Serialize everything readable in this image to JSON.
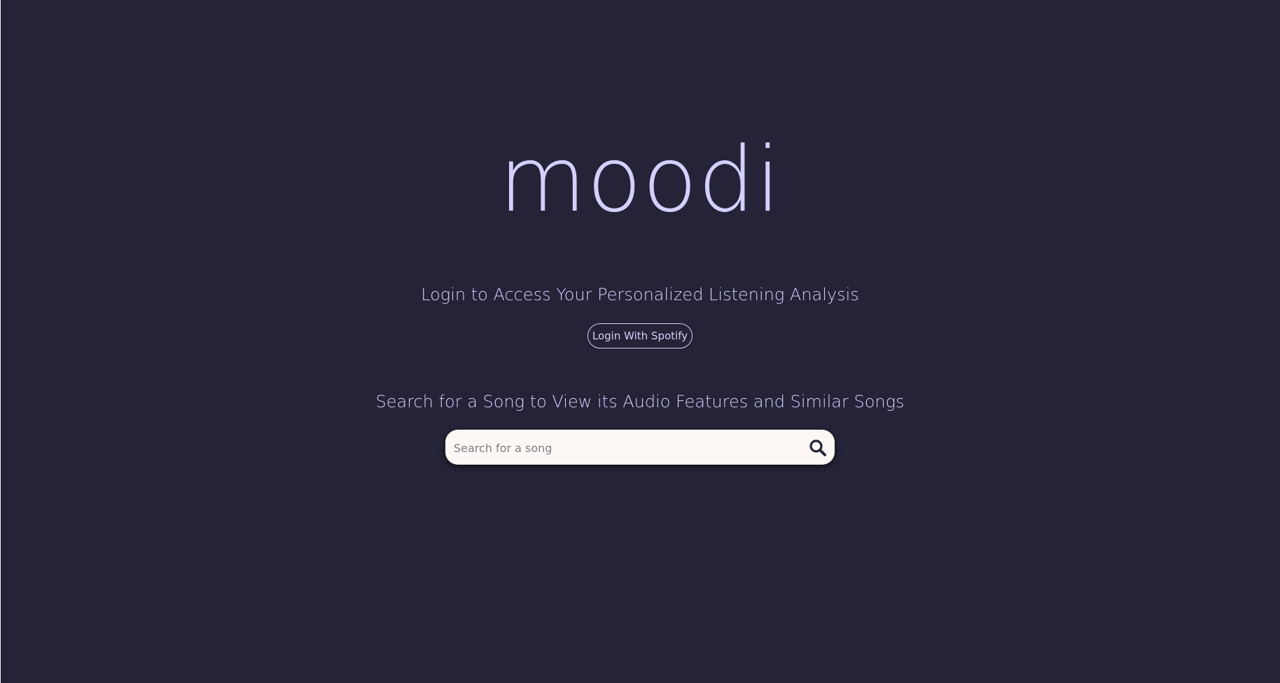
{
  "logo": {
    "text": "moodi"
  },
  "login": {
    "heading": "Login to Access Your Personalized Listening Analysis",
    "button_label": "Login With Spotify"
  },
  "search": {
    "heading": "Search for a Song to View its Audio Features and Similar Songs",
    "placeholder": "Search for a song",
    "value": "",
    "icon": "search-icon"
  },
  "colors": {
    "background": "#242337",
    "accent": "#d3d0fb",
    "search_field": "#fdf8f5"
  }
}
